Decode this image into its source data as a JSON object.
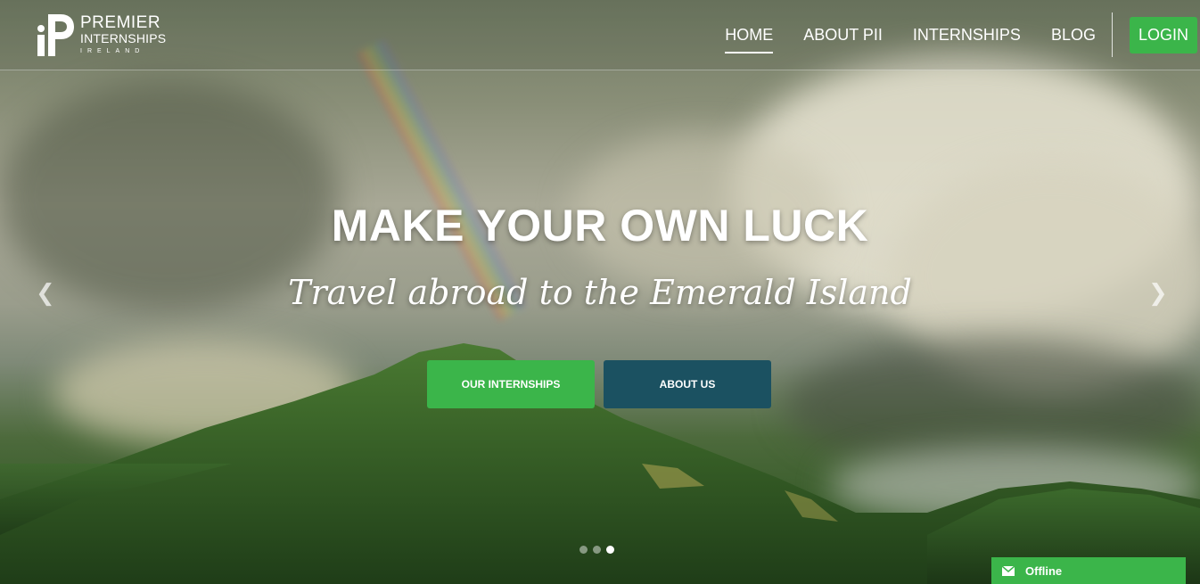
{
  "header": {
    "logo": {
      "line1": "PREMIER",
      "line2": "INTERNSHIPS",
      "line3": "IRELAND"
    },
    "nav": [
      {
        "label": "HOME",
        "active": true
      },
      {
        "label": "ABOUT PII",
        "active": false
      },
      {
        "label": "INTERNSHIPS",
        "active": false
      },
      {
        "label": "BLOG",
        "active": false
      }
    ],
    "login_label": "LOGIN"
  },
  "hero": {
    "headline": "MAKE YOUR OWN LUCK",
    "tagline": "Travel abroad to the Emerald Island",
    "buttons": {
      "primary": "OUR INTERNSHIPS",
      "secondary": "ABOUT US"
    },
    "carousel": {
      "slide_count": 3,
      "active_slide": 3,
      "prev_icon": "chevron-left-icon",
      "next_icon": "chevron-right-icon"
    }
  },
  "chat_widget": {
    "status": "Offline",
    "icon": "envelope-icon"
  },
  "colors": {
    "accent_green": "#3bb54a",
    "teal": "#1b5161"
  }
}
